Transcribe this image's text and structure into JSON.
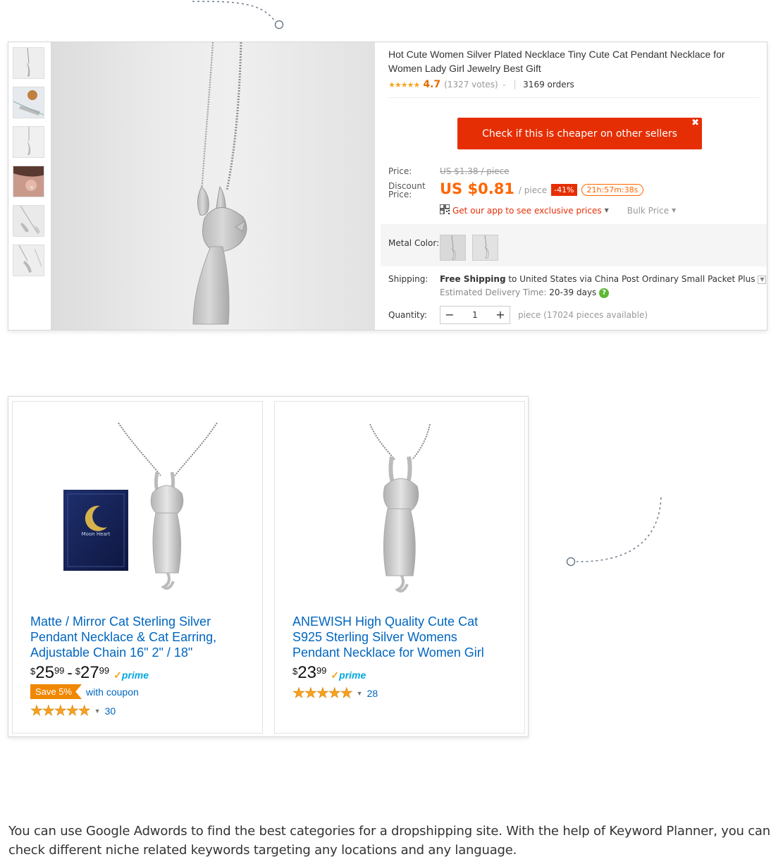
{
  "aliexpress": {
    "title": "Hot Cute Women Silver Plated Necklace Tiny Cute Cat Pendant Necklace for Women Lady Girl Jewelry Best Gift",
    "rating": "4.7",
    "votes": "(1327 votes)",
    "orders": "3169 orders",
    "cheaper_button": "Check if this is cheaper on other sellers",
    "close_glyph": "✖",
    "price_label": "Price:",
    "old_price": "US $1.38 / piece",
    "discount_label_1": "Discount",
    "discount_label_2": "Price:",
    "new_price": "US $0.81",
    "per_piece": "/ piece",
    "discount_badge": "-41%",
    "timer": "21h:57m:38s",
    "app_link": "Get our app to see exclusive prices",
    "bulk_price": "Bulk Price",
    "metal_color_label": "Metal Color:",
    "shipping_label": "Shipping:",
    "shipping_free": "Free Shipping",
    "shipping_rest": " to United States via China Post Ordinary Small Packet Plus",
    "delivery_label": "Estimated Delivery Time: ",
    "delivery_days": "20-39 days",
    "quantity_label": "Quantity:",
    "quantity_value": "1",
    "quantity_available": "piece (17024 pieces available)",
    "icons": [
      "qr-code-icon",
      "help-icon",
      "close-icon",
      "star-icon"
    ],
    "colors": {
      "accent": "#e62e04",
      "price": "#ff6600"
    }
  },
  "amazon": {
    "products": [
      {
        "title": "Matte / Mirror Cat Sterling Silver Pendant Necklace & Cat Earring, Adjustable Chain 16\" 2\" / 18\"",
        "price_low": {
          "whole": "25",
          "frac": "99"
        },
        "price_high": {
          "whole": "27",
          "frac": "99"
        },
        "currency": "$",
        "prime": "prime",
        "save_badge": "Save 5%",
        "coupon_text": "with coupon",
        "stars": "★★★★★",
        "review_count": "30",
        "box_text": "Moon Heart"
      },
      {
        "title": "ANEWISH High Quality Cute Cat S925 Sterling Silver Womens Pendant Necklace for Women Girl",
        "price": {
          "whole": "23",
          "frac": "99"
        },
        "currency": "$",
        "prime": "prime",
        "stars": "★★★★★",
        "review_count": "28"
      }
    ],
    "colors": {
      "link": "#0066c0",
      "star": "#f8a21d",
      "prime": "#00a8e1",
      "coupon": "#f08804"
    }
  },
  "body_text": "You can use Google Adwords to find the best categories for a dropshipping site. With the help of Keyword Planner, you can check different niche related keywords targeting any locations and any language."
}
